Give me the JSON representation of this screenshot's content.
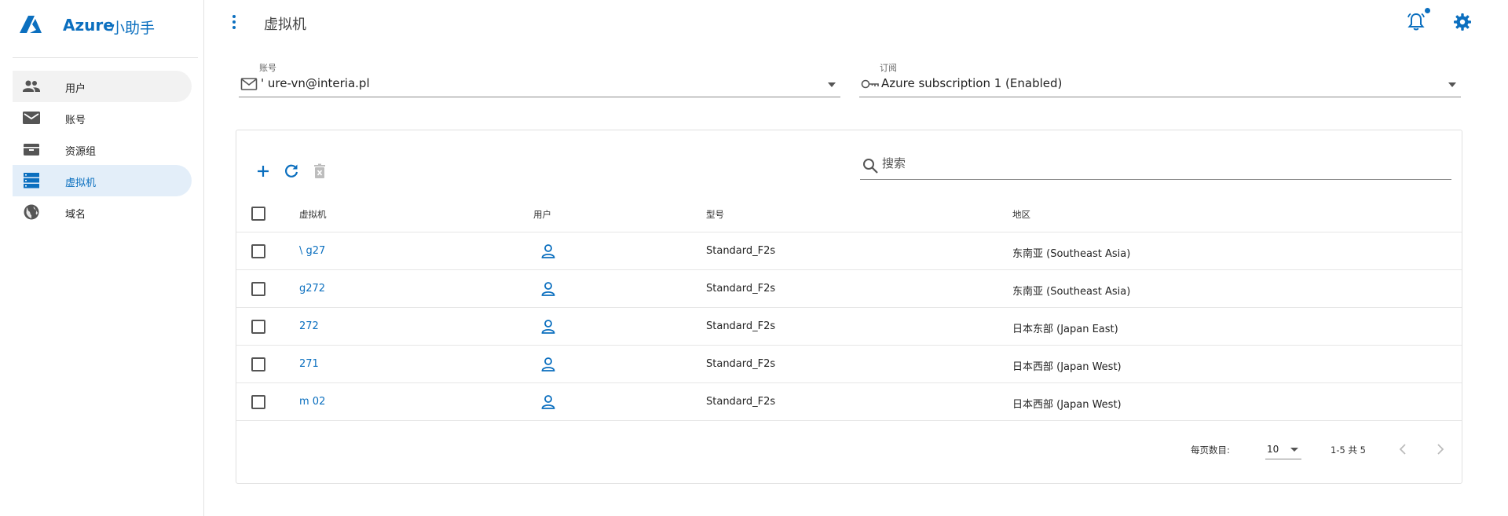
{
  "brand": {
    "name_latin": "Azure",
    "name_cn": "小助手",
    "accent": "#0b6fbf"
  },
  "sidebar": {
    "items": [
      {
        "label": "用户",
        "icon": "people-icon",
        "state": "hover"
      },
      {
        "label": "账号",
        "icon": "mail-icon",
        "state": "normal"
      },
      {
        "label": "资源组",
        "icon": "archive-icon",
        "state": "normal"
      },
      {
        "label": "虚拟机",
        "icon": "server-icon",
        "state": "active"
      },
      {
        "label": "域名",
        "icon": "globe-icon",
        "state": "normal"
      }
    ]
  },
  "header": {
    "title": "虚拟机",
    "notification_dot": true
  },
  "filters": {
    "account": {
      "label": "账号",
      "value": "'           ure-vn@interia.pl"
    },
    "subscription": {
      "label": "订阅",
      "value": "Azure subscription 1 (Enabled)"
    }
  },
  "search": {
    "placeholder": "搜索"
  },
  "table": {
    "columns": [
      "虚拟机",
      "用户",
      "型号",
      "地区"
    ],
    "rows": [
      {
        "vm": "\\ g27",
        "size": "Standard_F2s",
        "region": "东南亚 (Southeast Asia)"
      },
      {
        "vm": " g272",
        "size": "Standard_F2s",
        "region": "东南亚 (Southeast Asia)"
      },
      {
        "vm": " 272",
        "size": "Standard_F2s",
        "region": "日本东部 (Japan East)"
      },
      {
        "vm": " 271",
        "size": "Standard_F2s",
        "region": "日本西部 (Japan West)"
      },
      {
        "vm": "m  02",
        "size": "Standard_F2s",
        "region": "日本西部 (Japan West)"
      }
    ]
  },
  "pagination": {
    "per_page_label": "每页数目:",
    "per_page_value": "10",
    "range_text": "1-5 共 5"
  }
}
